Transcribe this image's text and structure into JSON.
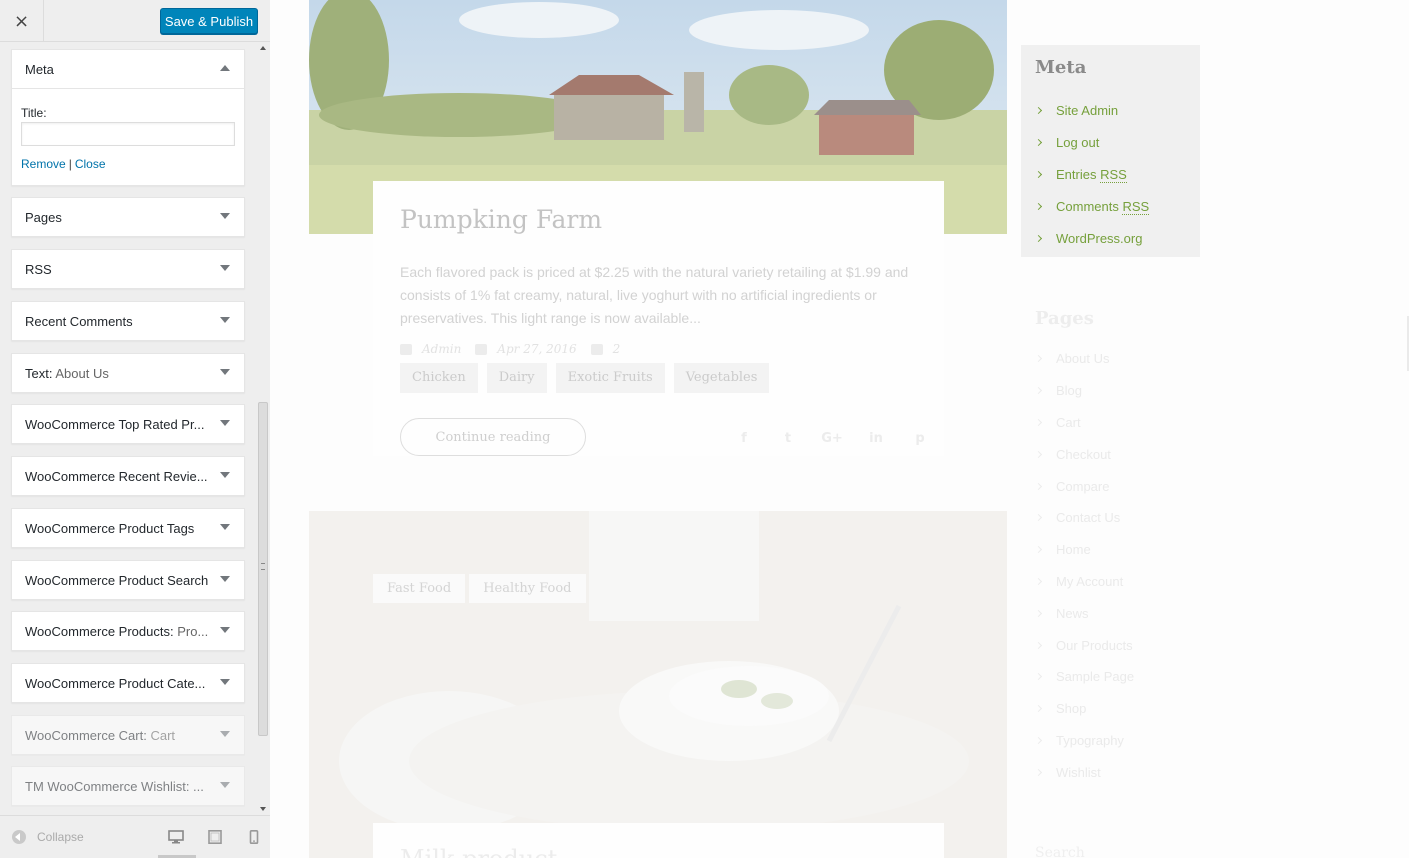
{
  "customizer": {
    "close_label": "×",
    "save_label": "Save & Publish",
    "widgets": [
      {
        "title": "Meta",
        "subtitle": "",
        "expanded": true
      },
      {
        "title": "Pages",
        "subtitle": ""
      },
      {
        "title": "RSS",
        "subtitle": ""
      },
      {
        "title": "Recent Comments",
        "subtitle": ""
      },
      {
        "title": "Text:",
        "subtitle": "About Us"
      },
      {
        "title": "WooCommerce Top Rated Pr...",
        "subtitle": ""
      },
      {
        "title": "WooCommerce Recent Revie...",
        "subtitle": ""
      },
      {
        "title": "WooCommerce Product Tags",
        "subtitle": ""
      },
      {
        "title": "WooCommerce Product Search",
        "subtitle": ""
      },
      {
        "title": "WooCommerce Products:",
        "subtitle": "Pro..."
      },
      {
        "title": "WooCommerce Product Cate...",
        "subtitle": ""
      },
      {
        "title": "WooCommerce Cart:",
        "subtitle": "Cart"
      },
      {
        "title": "TM WooCommerce Wishlist: ...",
        "subtitle": ""
      }
    ],
    "meta_form": {
      "title_label": "Title:",
      "title_value": "",
      "remove_label": "Remove",
      "separator": "|",
      "close_label": "Close"
    },
    "footer": {
      "collapse_label": "Collapse",
      "devices": [
        "desktop-icon",
        "tablet-icon",
        "mobile-icon"
      ],
      "active_device": "desktop"
    }
  },
  "preview": {
    "post1": {
      "title": "Pumpking Farm",
      "excerpt": "Each flavored pack is priced at $2.25 with the natural variety retailing at $1.99 and consists of 1% fat creamy, natural, live yoghurt with no artificial ingredients or preservatives. This light range is now available...",
      "author": "Admin",
      "date": "Apr 27, 2016",
      "comments": "2",
      "tags": [
        "Chicken",
        "Dairy",
        "Exotic Fruits",
        "Vegetables"
      ],
      "continue_label": "Continue reading",
      "share": [
        "f",
        "t",
        "G+",
        "in",
        "p"
      ]
    },
    "post2": {
      "tags": [
        "Fast Food",
        "Healthy Food"
      ],
      "title_fragment": "Milk product"
    },
    "meta_widget": {
      "title": "Meta",
      "links": [
        "Site Admin",
        "Log out",
        "Entries RSS",
        "Comments RSS",
        "WordPress.org"
      ]
    },
    "pages_widget": {
      "title": "Pages",
      "links": [
        "About Us",
        "Blog",
        "Cart",
        "Checkout",
        "Compare",
        "Contact Us",
        "Home",
        "My Account",
        "News",
        "Our Products",
        "Sample Page",
        "Shop",
        "Typography",
        "Wishlist"
      ]
    },
    "next_widget_fragment": "Search",
    "colors": {
      "accent_green": "#76a03c",
      "button_blue": "#0085ba",
      "link_blue": "#0073aa"
    }
  }
}
